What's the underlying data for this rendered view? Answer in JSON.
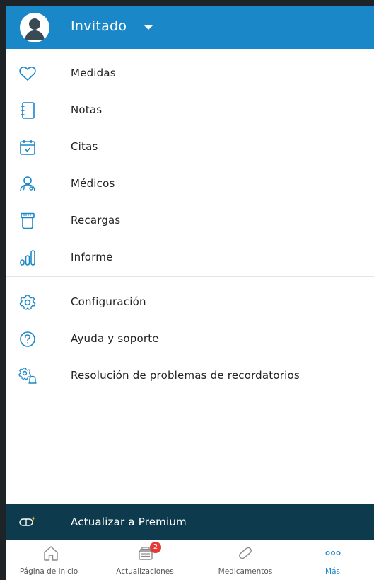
{
  "colors": {
    "header_bg": "#1a87c9",
    "icon_blue": "#1a87c9",
    "premium_bg": "#0e3a4e",
    "badge_red": "#e53935",
    "active_nav": "#1a87c9"
  },
  "header": {
    "user_name": "Invitado",
    "avatar_icon": "user-avatar-icon",
    "dropdown_icon": "caret-down-icon"
  },
  "menu": {
    "items": [
      {
        "label": "Medidas",
        "icon": "heart-icon"
      },
      {
        "label": "Notas",
        "icon": "notebook-icon"
      },
      {
        "label": "Citas",
        "icon": "calendar-check-icon"
      },
      {
        "label": "Médicos",
        "icon": "doctor-icon"
      },
      {
        "label": "Recargas",
        "icon": "pill-bottle-icon"
      },
      {
        "label": "Informe",
        "icon": "bar-chart-icon"
      },
      {
        "label": "Configuración",
        "icon": "gear-icon"
      },
      {
        "label": "Ayuda y soporte",
        "icon": "help-icon"
      },
      {
        "label": "Resolución de problemas de recordatorios",
        "icon": "gear-bell-icon"
      }
    ]
  },
  "premium": {
    "label": "Actualizar a Premium",
    "icon": "premium-pill-icon"
  },
  "bottom_nav": {
    "items": [
      {
        "label": "Página de inicio",
        "icon": "home-icon"
      },
      {
        "label": "Actualizaciones",
        "icon": "updates-icon",
        "badge": "2"
      },
      {
        "label": "Medicamentos",
        "icon": "pill-icon"
      },
      {
        "label": "Más",
        "icon": "more-icon",
        "active": true
      }
    ]
  }
}
